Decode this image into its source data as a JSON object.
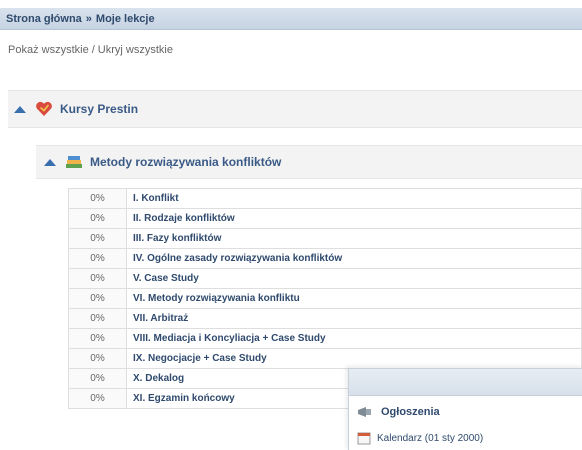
{
  "breadcrumb": {
    "home": "Strona główna",
    "separator": "»",
    "current": "Moje lekcje"
  },
  "toggle": {
    "show_all": "Pokaż wszystkie",
    "separator": "/",
    "hide_all": "Ukryj wszystkie"
  },
  "category": {
    "label": "Kursy Prestin",
    "icon": "heart-icon"
  },
  "course": {
    "label": "Metody rozwiązywania konfliktów",
    "icon": "books-icon"
  },
  "lessons": [
    {
      "percent": "0%",
      "title": "I. Konflikt"
    },
    {
      "percent": "0%",
      "title": "II. Rodzaje konfliktów"
    },
    {
      "percent": "0%",
      "title": "III. Fazy konfliktów"
    },
    {
      "percent": "0%",
      "title": "IV. Ogólne zasady rozwiązywania konfliktów"
    },
    {
      "percent": "0%",
      "title": "V. Case Study"
    },
    {
      "percent": "0%",
      "title": "VI. Metody rozwiązywania konfliktu"
    },
    {
      "percent": "0%",
      "title": "VII. Arbitraż"
    },
    {
      "percent": "0%",
      "title": "VIII. Mediacja i Koncyliacja + Case Study"
    },
    {
      "percent": "0%",
      "title": "IX. Negocjacje + Case Study"
    },
    {
      "percent": "0%",
      "title": "X. Dekalog"
    },
    {
      "percent": "0%",
      "title": "XI. Egzamin końcowy"
    }
  ],
  "announcements": {
    "title": "Ogłoszenia",
    "item": "Kalendarz (01 sty 2000)"
  },
  "colors": {
    "accent": "#3a6fae",
    "link": "#2f4a6d"
  }
}
